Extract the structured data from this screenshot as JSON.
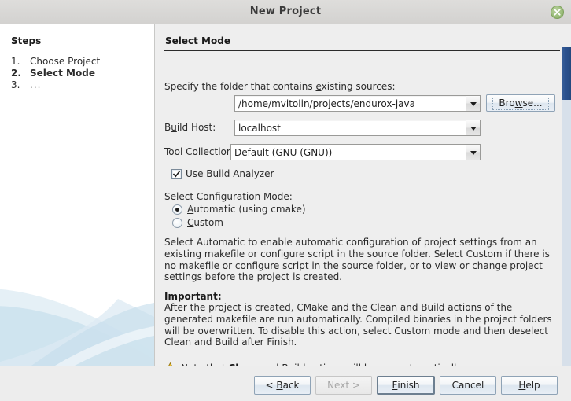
{
  "window": {
    "title": "New Project",
    "close_icon": "close-icon"
  },
  "sidebar": {
    "heading": "Steps",
    "steps": [
      {
        "num": "1.",
        "label": "Choose Project",
        "current": false
      },
      {
        "num": "2.",
        "label": "Select Mode",
        "current": true
      },
      {
        "num": "3.",
        "label": "...",
        "current": false
      }
    ]
  },
  "main": {
    "section_title": "Select Mode",
    "folder_label_pre": "Specify the folder that contains ",
    "folder_label_mnemonic": "e",
    "folder_label_post": "xisting sources:",
    "folder_value": "/home/mvitolin/projects/endurox-java",
    "browse_label_pre": "Bro",
    "browse_label_mnemonic": "w",
    "browse_label_post": "se...",
    "build_host_label_pre": "B",
    "build_host_label_mnemonic": "u",
    "build_host_label_post": "ild Host:",
    "build_host_value": "localhost",
    "tool_collection_label_pre": "",
    "tool_collection_label_mnemonic": "T",
    "tool_collection_label_post": "ool Collection:",
    "tool_collection_value": "Default (GNU (GNU))",
    "use_build_analyzer_pre": "U",
    "use_build_analyzer_mnemonic": "s",
    "use_build_analyzer_post": "e Build Analyzer",
    "use_build_analyzer_checked": true,
    "config_mode_label_pre": "Select Configuration ",
    "config_mode_label_mnemonic": "M",
    "config_mode_label_post": "ode:",
    "radio_automatic_mnemonic": "A",
    "radio_automatic_post": "utomatic (using cmake)",
    "radio_automatic_selected": true,
    "radio_custom_mnemonic": "C",
    "radio_custom_post": "ustom",
    "radio_custom_selected": false,
    "description": "Select Automatic to enable automatic configuration of project settings from an existing makefile or configure script in the source folder. Select Custom if there is no makefile or configure script in the source folder, or to view or change project settings before the project is created.",
    "important_heading": "Important:",
    "important_text": "After the project is created, CMake and the Clean and Build actions of the generated makefile are run automatically. Compiled binaries in the project folders will be overwritten. To disable this action, select Custom mode and then deselect Clean and Build after Finish.",
    "note_icon": "warning-triangle-icon",
    "note_pre": "Note that ",
    "note_bold": "Clean",
    "note_post": " and Build actions will be run automatically"
  },
  "footer": {
    "back_pre": "< ",
    "back_mnemonic": "B",
    "back_post": "ack",
    "next_label": "Next >",
    "next_enabled": false,
    "finish_mnemonic": "F",
    "finish_post": "inish",
    "finish_default": true,
    "cancel_label": "Cancel",
    "help_mnemonic": "H",
    "help_post": "elp"
  },
  "colors": {
    "title_bar": "#d8d7d5",
    "panel_bg": "#eeeeee",
    "sidebar_bg": "#ffffff",
    "scrollbar_thumb": "#2b5290",
    "scrollbar_track": "#d7e0ea",
    "close_button": "#9dbf7d",
    "warning": "#f0c020"
  }
}
